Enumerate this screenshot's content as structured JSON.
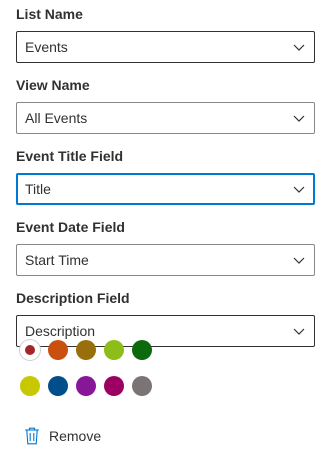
{
  "fields": [
    {
      "label": "List Name",
      "value": "Events"
    },
    {
      "label": "View Name",
      "value": "All Events"
    },
    {
      "label": "Event Title Field",
      "value": "Title"
    },
    {
      "label": "Event Date Field",
      "value": "Start Time"
    },
    {
      "label": "Description Field",
      "value": "Description"
    }
  ],
  "colors": {
    "row1": [
      {
        "name": "red",
        "hex": "#a4262c",
        "selected": true
      },
      {
        "name": "orange",
        "hex": "#ca5010",
        "selected": false
      },
      {
        "name": "gold",
        "hex": "#986f0b",
        "selected": false
      },
      {
        "name": "lime",
        "hex": "#8cbd18",
        "selected": false
      },
      {
        "name": "green",
        "hex": "#0b6a0b",
        "selected": false
      }
    ],
    "row2": [
      {
        "name": "yellow",
        "hex": "#c8c800",
        "selected": false
      },
      {
        "name": "blue",
        "hex": "#004e8c",
        "selected": false
      },
      {
        "name": "purple",
        "hex": "#881798",
        "selected": false
      },
      {
        "name": "magenta",
        "hex": "#9b0062",
        "selected": false
      },
      {
        "name": "gray",
        "hex": "#7a7574",
        "selected": false
      }
    ]
  },
  "remove": {
    "label": "Remove",
    "icon": "trash-icon"
  },
  "theme": {
    "accent": "#0078d4",
    "border": "#8a8886",
    "text": "#323130"
  }
}
